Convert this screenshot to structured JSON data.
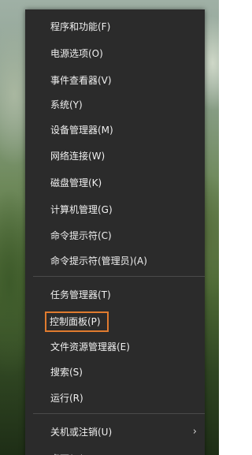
{
  "menu": {
    "group1": [
      {
        "label": "程序和功能(F)"
      },
      {
        "label": "电源选项(O)"
      },
      {
        "label": "事件查看器(V)"
      },
      {
        "label": "系统(Y)"
      },
      {
        "label": "设备管理器(M)"
      },
      {
        "label": "网络连接(W)"
      },
      {
        "label": "磁盘管理(K)"
      },
      {
        "label": "计算机管理(G)"
      },
      {
        "label": "命令提示符(C)"
      },
      {
        "label": "命令提示符(管理员)(A)"
      }
    ],
    "group2": [
      {
        "label": "任务管理器(T)"
      },
      {
        "label": "控制面板(P)"
      },
      {
        "label": "文件资源管理器(E)"
      },
      {
        "label": "搜索(S)"
      },
      {
        "label": "运行(R)"
      }
    ],
    "group3": [
      {
        "label": "关机或注销(U)",
        "submenu_arrow": "›"
      },
      {
        "label": "桌面(D)"
      }
    ]
  }
}
